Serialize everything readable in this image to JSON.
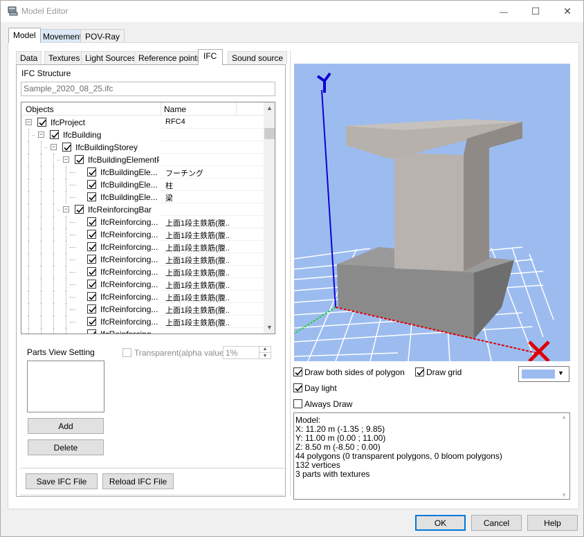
{
  "window": {
    "title": "Model Editor",
    "min_glyph": "—",
    "max_glyph": "☐",
    "close_glyph": "✕"
  },
  "main_tabs": [
    {
      "label": "Model"
    },
    {
      "label": "Movement"
    },
    {
      "label": "POV-Ray"
    }
  ],
  "sub_tabs": [
    {
      "label": "Data"
    },
    {
      "label": "Textures"
    },
    {
      "label": "Light Sources"
    },
    {
      "label": "Reference points"
    },
    {
      "label": "IFC"
    },
    {
      "label": "Sound source"
    }
  ],
  "ifc": {
    "structure_label": "IFC Structure",
    "file_name": "Sample_2020_08_25.ifc",
    "columns": {
      "objects": "Objects",
      "name": "Name"
    },
    "rows": [
      {
        "label": "IfcProject",
        "name": "RFC4"
      },
      {
        "label": "IfcBuilding",
        "name": ""
      },
      {
        "label": "IfcBuildingStorey",
        "name": ""
      },
      {
        "label": "IfcBuildingElementProxy",
        "name": ""
      },
      {
        "label": "IfcBuildingEle...",
        "name": "フーチング"
      },
      {
        "label": "IfcBuildingEle...",
        "name": "柱"
      },
      {
        "label": "IfcBuildingEle...",
        "name": "梁"
      },
      {
        "label": "IfcReinforcingBar",
        "name": ""
      },
      {
        "label": "IfcReinforcing...",
        "name": "上面1段主鉄筋(腹..."
      },
      {
        "label": "IfcReinforcing...",
        "name": "上面1段主鉄筋(腹..."
      },
      {
        "label": "IfcReinforcing...",
        "name": "上面1段主鉄筋(腹..."
      },
      {
        "label": "IfcReinforcing...",
        "name": "上面1段主鉄筋(腹..."
      },
      {
        "label": "IfcReinforcing...",
        "name": "上面1段主鉄筋(腹..."
      },
      {
        "label": "IfcReinforcing...",
        "name": "上面1段主鉄筋(腹..."
      },
      {
        "label": "IfcReinforcing...",
        "name": "上面1段主鉄筋(腹..."
      },
      {
        "label": "IfcReinforcing...",
        "name": "上面1段主鉄筋(腹..."
      },
      {
        "label": "IfcReinforcing...",
        "name": "上面1段主鉄筋(腹..."
      },
      {
        "label": "IfcReinforcing...",
        "name": ""
      }
    ],
    "parts_view_setting": "Parts View Setting",
    "transparent_label": "Transparent(alpha value)",
    "alpha_value": "1%",
    "add_label": "Add",
    "delete_label": "Delete",
    "save_label": "Save IFC File",
    "reload_label": "Reload IFC File"
  },
  "viewport": {
    "background_color": "#9cbcf0",
    "axis_labels": {
      "y": "Y",
      "x": "X"
    }
  },
  "options": {
    "draw_both_sides": "Draw both sides of polygon",
    "draw_grid": "Draw grid",
    "day_light": "Day light",
    "always_draw": "Always Draw",
    "draw_both_sides_checked": true,
    "draw_grid_checked": true,
    "day_light_checked": true,
    "always_draw_checked": false,
    "grid_color": "#9cbcf0"
  },
  "info": {
    "lines": [
      "Model:",
      "X: 11.20 m (-1.35 ; 9.85)",
      "Y: 11.00 m (0.00 ; 11.00)",
      "Z: 8.50 m (-8.50 ; 0.00)",
      "44 polygons (0 transparent polygons, 0 bloom polygons)",
      "132 vertices",
      "3 parts with textures"
    ]
  },
  "footer": {
    "ok": "OK",
    "cancel": "Cancel",
    "help": "Help"
  }
}
